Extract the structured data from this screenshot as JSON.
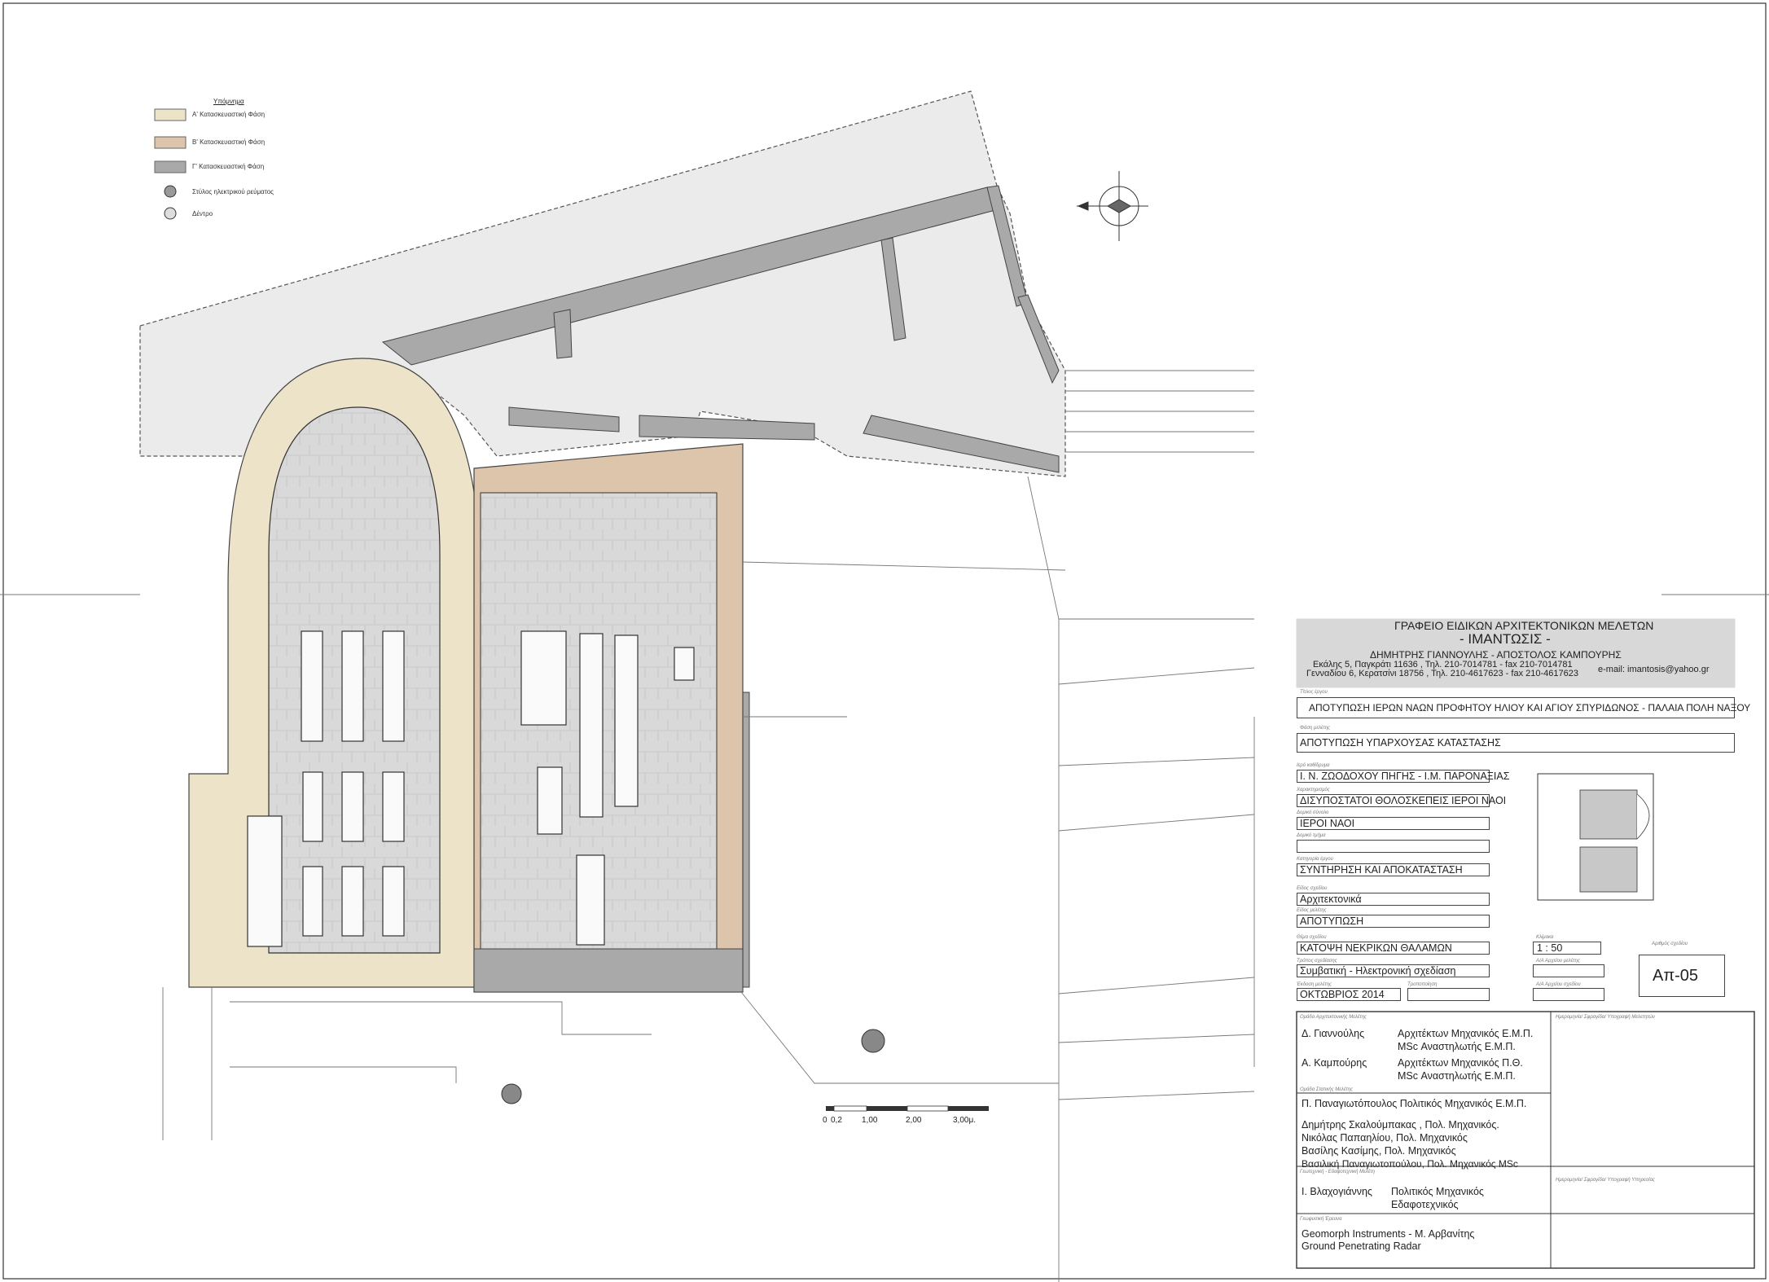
{
  "legend": {
    "title": "Υπόμνημα",
    "items": [
      {
        "label": "Α' Κατασκευαστική Φάση",
        "color": "#ece3c9"
      },
      {
        "label": "Β' Κατασκευαστική Φάση",
        "color": "#dcc5ab"
      },
      {
        "label": "Γ' Κατασκευαστική Φάση",
        "color": "#a9a9a9"
      },
      {
        "label": "Στύλος ηλεκτρικού ρεύματος",
        "icon": "pole-icon"
      },
      {
        "label": "Δέντρο",
        "icon": "tree-icon"
      }
    ]
  },
  "colors": {
    "phase_a": "#ece3c9",
    "phase_b": "#dcc5ab",
    "phase_c": "#a9a9a9",
    "existing_building": "#e8e8e8",
    "line": "#3a3a3a"
  },
  "office": {
    "name": "ΓΡΑΦΕΙΟ ΕΙΔΙΚΩΝ ΑΡΧΙΤΕΚΤΟΝΙΚΩΝ ΜΕΛΕΤΩΝ",
    "brand": "- ΙΜΑΝΤΩΣΙΣ -",
    "partners": "ΔΗΜΗΤΡΗΣ ΓΙΑΝΝΟΥΛΗΣ  -  ΑΠΟΣΤΟΛΟΣ ΚΑΜΠΟΥΡΗΣ",
    "address1": "Εκάλης 5, Παγκράτι 11636 , Τηλ. 210-7014781 - fax 210-7014781",
    "address2": "Γενναδίου 6, Κερατσίνι 18756 , Τηλ. 210-4617623 - fax 210-4617623",
    "email": "e-mail: imantosis@yahoo.gr"
  },
  "title_block": {
    "project_label": "Τίτλος έργου",
    "project": "ΑΠΟΤΥΠΩΣΗ ΙΕΡΩΝ ΝΑΩΝ ΠΡΟΦΗΤΟΥ ΗΛΙΟΥ ΚΑΙ ΑΓΙΟΥ ΣΠΥΡΙΔΩΝΟΣ - ΠΑΛΑΙΑ ΠΟΛΗ ΝΑΞΟΥ",
    "phase_label": "Φάση μελέτης",
    "phase": "ΑΠΟΤΥΠΩΣΗ ΥΠΑΡΧΟΥΣΑΣ ΚΑΤΑΣΤΑΣΗΣ",
    "owner_label": "Ιερό καθίδρυμα",
    "owner": "Ι. Ν. ΖΩΟΔΟΧΟΥ ΠΗΓΗΣ - Ι.Μ. ΠΑΡΟΝΑΞΙΑΣ",
    "type_label": "Χαρακτηρισμός",
    "type": "ΔΙΣΥΠΟΣΤΑΤΟΙ ΘΟΛΟΣΚΕΠΕΙΣ ΙΕΡΟΙ ΝΑΟΙ",
    "building_label": "Δομικό σύνολο",
    "building": "ΙΕΡΟΙ ΝΑΟΙ",
    "part_label": "Δομικό τμήμα",
    "part": "",
    "category_label": "Κατηγορία έργου",
    "category": "ΣΥΝΤΗΡΗΣΗ ΚΑΙ ΑΠΟΚΑΤΑΣΤΑΣΗ",
    "drawing_type_label": "Είδος σχεδίου",
    "drawing_type": "Αρχιτεκτονικά",
    "study_type_label": "Είδος μελέτης",
    "study_type": "ΑΠΟΤΥΠΩΣΗ",
    "subject_label": "Θέμα σχεδίου",
    "subject": "ΚΑΤΟΨΗ ΝΕΚΡΙΚΩΝ ΘΑΛΑΜΩΝ",
    "scale_label": "Κλίμακα",
    "scale": "1 : 50",
    "number_label": "Αριθμός σχεδίου",
    "number": "Απ-05",
    "method_label": "Τρόπος σχεδίασης",
    "method": "Συμβατική - Ηλεκτρονική σχεδίαση",
    "file_label": "Α/Α Αρχείου μελέτης",
    "date_label": "Έκδοση μελέτης",
    "date": "ΟΚΤΩΒΡΙΟΣ 2014",
    "revision_label": "Τροποποίηση",
    "file2_label": "Α/Α Αρχείου σχεδίου"
  },
  "team": {
    "arch_label": "Ομάδα Αρχιτεκτονικής Μελέτης",
    "sign_label": "Ημερομηνία/ Σφραγίδα/ Υπογραφή Μελετητών",
    "arch": [
      {
        "name": "Δ. Γιαννούλης",
        "title1": "Αρχιτέκτων Μηχανικός Ε.Μ.Π.",
        "title2": "MSc Αναστηλωτής Ε.Μ.Π."
      },
      {
        "name": "Α. Καμπούρης",
        "title1": "Αρχιτέκτων Μηχανικός Π.Θ.",
        "title2": "MSc Αναστηλωτής Ε.Μ.Π."
      }
    ],
    "static_label": "Ομάδα Στατικής Μελέτης",
    "static_lead": "Π. Παναγιωτόπουλος   Πολιτικός Μηχανικός Ε.Μ.Π.",
    "static_members": [
      "Δημήτρης Σκαλούμπακας , Πολ. Μηχανικός.",
      "Νικόλας Παπαηλίου, Πολ. Μηχανικός",
      "Βασίλης Κασίμης, Πολ. Μηχανικός",
      "Βασιλική Παναγιωτοπούλου, Πολ. Μηχανικός MSc"
    ],
    "geo_label": "Γεωτεχνική - Εδαφοτεχνική Μελέτη",
    "sign2_label": "Ημερομηνία/ Σφραγίδα/ Υπογραφή Υπηρεσίας",
    "geo_name": "Ι. Βλαχογιάννης",
    "geo_title1": "Πολιτικός Μηχανικός",
    "geo_title2": "Εδαφοτεχνικός",
    "geophys_label": "Γεωφυσική Έρευνα",
    "geophys1": "Geomorph Instruments - Μ. Αρβανίτης",
    "geophys2": "Ground Penetrating Radar"
  },
  "scale_bar": {
    "ticks": [
      "0",
      "0,2",
      "1,00",
      "2,00",
      "3,00μ."
    ]
  }
}
